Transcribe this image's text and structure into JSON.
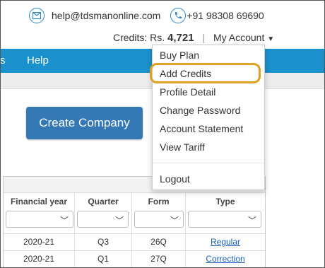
{
  "header": {
    "email": "help@tdsmanonline.com",
    "phone": "+91 98308 69690",
    "credits_label": "Credits: Rs.",
    "credits_value": "4,721",
    "separator": "|",
    "my_account": "My Account"
  },
  "nav": {
    "items": [
      {
        "label": "s"
      },
      {
        "label": "Help"
      }
    ]
  },
  "main": {
    "create_company": "Create Company"
  },
  "dropdown": {
    "items": [
      {
        "label": "Buy Plan"
      },
      {
        "label": "Add Credits"
      },
      {
        "label": "Profile Detail"
      },
      {
        "label": "Change Password"
      },
      {
        "label": "Account Statement"
      },
      {
        "label": "View Tariff"
      }
    ],
    "logout": "Logout"
  },
  "table": {
    "headers": [
      "Financial year",
      "Quarter",
      "Form",
      "Type"
    ],
    "rows": [
      [
        "2020-21",
        "Q3",
        "26Q",
        "Regular"
      ],
      [
        "2020-21",
        "Q1",
        "27Q",
        "Correction"
      ]
    ]
  },
  "colors": {
    "nav": "#1a90cc",
    "button": "#3578b6",
    "highlight": "#e0a020",
    "icon": "#2a87c9"
  }
}
